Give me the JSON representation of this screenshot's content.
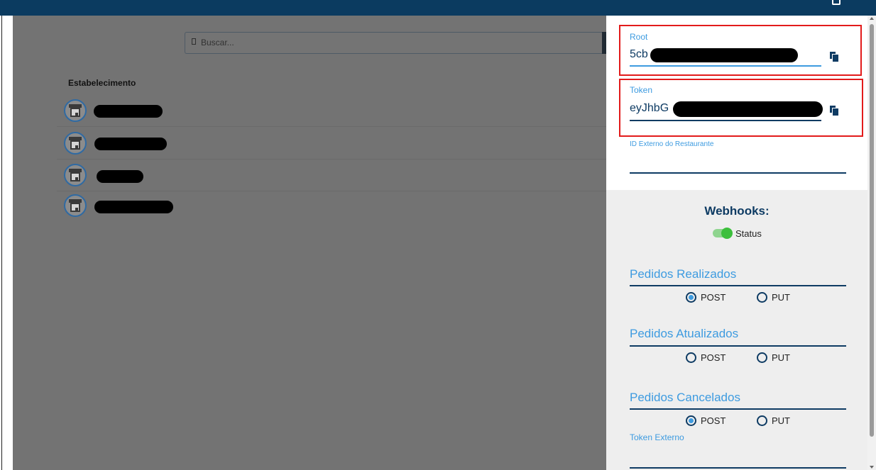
{
  "search": {
    "placeholder": "Buscar..."
  },
  "list": {
    "header": "Estabelecimento",
    "rows": [
      {
        "name": ""
      },
      {
        "name": ""
      },
      {
        "name": ""
      },
      {
        "name": ""
      }
    ]
  },
  "drawer": {
    "root": {
      "label": "Root",
      "value": "5cb"
    },
    "token": {
      "label": "Token",
      "value": "eyJhbG"
    },
    "external_id": {
      "label": "ID Externo do Restaurante",
      "value": ""
    },
    "webhooks": {
      "title": "Webhooks:",
      "status_label": "Status",
      "status_on": true,
      "sections": [
        {
          "title": "Pedidos Realizados",
          "options": [
            "POST",
            "PUT"
          ],
          "selected": "POST"
        },
        {
          "title": "Pedidos Atualizados",
          "options": [
            "POST",
            "PUT"
          ],
          "selected": null
        },
        {
          "title": "Pedidos Cancelados",
          "options": [
            "POST",
            "PUT"
          ],
          "selected": "POST"
        }
      ],
      "external_token_label": "Token Externo"
    }
  },
  "colors": {
    "topbar": "#0b3b60",
    "accent": "#3d9be0",
    "navy": "#0e3b63",
    "highlight_border": "#e21b1b",
    "toggle_on": "#3cbf3c"
  }
}
